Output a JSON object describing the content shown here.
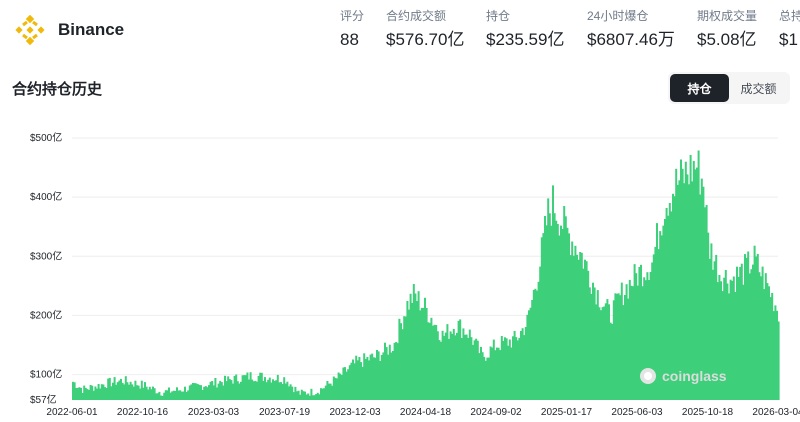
{
  "brand": {
    "name": "Binance",
    "logo_icon": "binance-logo-icon"
  },
  "stats": [
    {
      "label": "评分",
      "value": "88"
    },
    {
      "label": "合约成交额",
      "value": "$576.70亿"
    },
    {
      "label": "持仓",
      "value": "$235.59亿"
    },
    {
      "label": "24小时爆仓",
      "value": "$6807.46万"
    },
    {
      "label": "期权成交量",
      "value": "$5.08亿"
    },
    {
      "label": "总持",
      "value": "$1"
    }
  ],
  "section": {
    "title": "合约持仓历史"
  },
  "toggle": [
    {
      "label": "持仓",
      "active": true
    },
    {
      "label": "成交额",
      "active": false
    }
  ],
  "colors": {
    "series": "#3ecf7b",
    "brand": "#f0b90b",
    "grid": "#eeeeee"
  },
  "watermark": {
    "text": "coinglass",
    "icon": "coinglass-logo-icon"
  },
  "chart_data": {
    "type": "area",
    "xlabel": "",
    "ylabel": "",
    "y_ticks": [
      {
        "value": 57,
        "label": "$57亿"
      },
      {
        "value": 100,
        "label": "$100亿"
      },
      {
        "value": 200,
        "label": "$200亿"
      },
      {
        "value": 300,
        "label": "$300亿"
      },
      {
        "value": 400,
        "label": "$400亿"
      },
      {
        "value": 500,
        "label": "$500亿"
      }
    ],
    "ylim": [
      57,
      500
    ],
    "x_ticks": [
      "2022-06-01",
      "2022-10-16",
      "2023-03-03",
      "2023-07-19",
      "2023-12-03",
      "2024-04-18",
      "2024-09-02",
      "2025-01-17",
      "2025-06-03",
      "2025-10-18",
      "2026-03-04"
    ],
    "grid": true,
    "legend": "none",
    "series": [
      {
        "points": [
          [
            "2022-06-01",
            88
          ],
          [
            "2022-06-20",
            75
          ],
          [
            "2022-07-15",
            80
          ],
          [
            "2022-08-10",
            86
          ],
          [
            "2022-09-05",
            90
          ],
          [
            "2022-10-16",
            82
          ],
          [
            "2022-11-20",
            70
          ],
          [
            "2022-12-25",
            74
          ],
          [
            "2023-01-30",
            80
          ],
          [
            "2023-03-03",
            86
          ],
          [
            "2023-04-10",
            92
          ],
          [
            "2023-05-15",
            98
          ],
          [
            "2023-06-20",
            95
          ],
          [
            "2023-07-19",
            93
          ],
          [
            "2023-08-15",
            68
          ],
          [
            "2023-09-20",
            72
          ],
          [
            "2023-10-25",
            92
          ],
          [
            "2023-12-03",
            120
          ],
          [
            "2024-01-10",
            130
          ],
          [
            "2024-02-15",
            150
          ],
          [
            "2024-03-10",
            215
          ],
          [
            "2024-03-25",
            235
          ],
          [
            "2024-04-18",
            210
          ],
          [
            "2024-05-20",
            165
          ],
          [
            "2024-06-15",
            185
          ],
          [
            "2024-07-10",
            170
          ],
          [
            "2024-08-05",
            130
          ],
          [
            "2024-09-02",
            150
          ],
          [
            "2024-10-10",
            160
          ],
          [
            "2024-11-01",
            190
          ],
          [
            "2024-11-25",
            290
          ],
          [
            "2024-12-10",
            370
          ],
          [
            "2024-12-20",
            390
          ],
          [
            "2025-01-17",
            340
          ],
          [
            "2025-02-15",
            300
          ],
          [
            "2025-03-15",
            240
          ],
          [
            "2025-04-10",
            200
          ],
          [
            "2025-05-05",
            240
          ],
          [
            "2025-06-03",
            270
          ],
          [
            "2025-07-01",
            290
          ],
          [
            "2025-07-25",
            390
          ],
          [
            "2025-08-15",
            420
          ],
          [
            "2025-09-05",
            440
          ],
          [
            "2025-09-25",
            455
          ],
          [
            "2025-10-10",
            420
          ],
          [
            "2025-10-18",
            320
          ],
          [
            "2025-11-10",
            270
          ],
          [
            "2025-12-01",
            260
          ],
          [
            "2025-12-25",
            275
          ],
          [
            "2026-01-15",
            295
          ],
          [
            "2026-02-10",
            250
          ],
          [
            "2026-03-04",
            205
          ]
        ]
      }
    ]
  }
}
